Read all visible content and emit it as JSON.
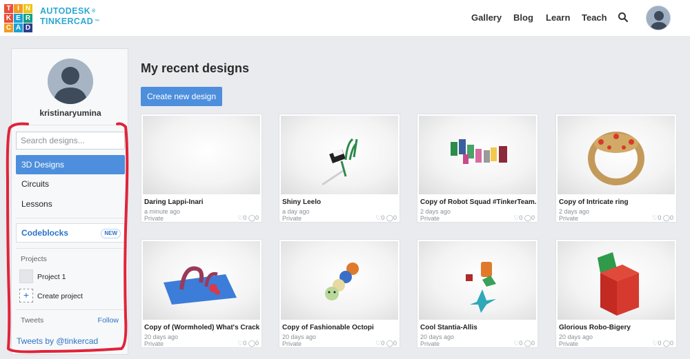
{
  "header": {
    "logo_letters": [
      "T",
      "I",
      "N",
      "K",
      "E",
      "R",
      "C",
      "A",
      "D"
    ],
    "logo_colors": [
      "#e94e3c",
      "#f39c22",
      "#f1c40f",
      "#e94e3c",
      "#1ba1d6",
      "#16a085",
      "#f39c22",
      "#1ba1d6",
      "#2d3e8c"
    ],
    "brand_line1": "AUTODESK",
    "brand_line2": "TINKERCAD",
    "brand_mark": "®",
    "brand_tm": "™",
    "nav": [
      "Gallery",
      "Blog",
      "Learn",
      "Teach"
    ],
    "search_icon": "search-icon"
  },
  "sidebar": {
    "username": "kristinaryumina",
    "search_placeholder": "Search designs...",
    "menu": [
      "3D Designs",
      "Circuits",
      "Lessons"
    ],
    "active_menu": "3D Designs",
    "codeblocks": "Codeblocks",
    "codeblocks_badge": "NEW",
    "projects_label": "Projects",
    "projects": [
      "Project 1"
    ],
    "create_project": "Create project",
    "create_project_icon": "+",
    "tweets_label": "Tweets",
    "follow": "Follow",
    "tweets_by": "Tweets by @tinkercad"
  },
  "main": {
    "title": "My recent designs",
    "create_button": "Create new design",
    "designs": [
      {
        "title": "Daring Lappi-Inari",
        "time": "a minute ago",
        "visibility": "Private",
        "likes": "0",
        "comments": "0"
      },
      {
        "title": "Shiny Leelo",
        "time": "a day ago",
        "visibility": "Private",
        "likes": "0",
        "comments": "0"
      },
      {
        "title": "Copy of Robot Squad #TinkerTeam...",
        "time": "2 days ago",
        "visibility": "Private",
        "likes": "0",
        "comments": "0"
      },
      {
        "title": "Copy of Intricate ring",
        "time": "2 days ago",
        "visibility": "Private",
        "likes": "0",
        "comments": "0"
      },
      {
        "title": "Copy of (Wormholed) What's Crack...",
        "time": "20 days ago",
        "visibility": "Private",
        "likes": "0",
        "comments": "0"
      },
      {
        "title": "Copy of Fashionable Octopi",
        "time": "20 days ago",
        "visibility": "Private",
        "likes": "0",
        "comments": "0"
      },
      {
        "title": "Cool Stantia-Allis",
        "time": "20 days ago",
        "visibility": "Private",
        "likes": "0",
        "comments": "0"
      },
      {
        "title": "Glorious Robo-Bigery",
        "time": "20 days ago",
        "visibility": "Private",
        "likes": "0",
        "comments": "0"
      }
    ]
  },
  "colors": {
    "brand_blue": "#2ca8d2",
    "accent": "#4d8fdc",
    "annotation_red": "#e0233a"
  }
}
